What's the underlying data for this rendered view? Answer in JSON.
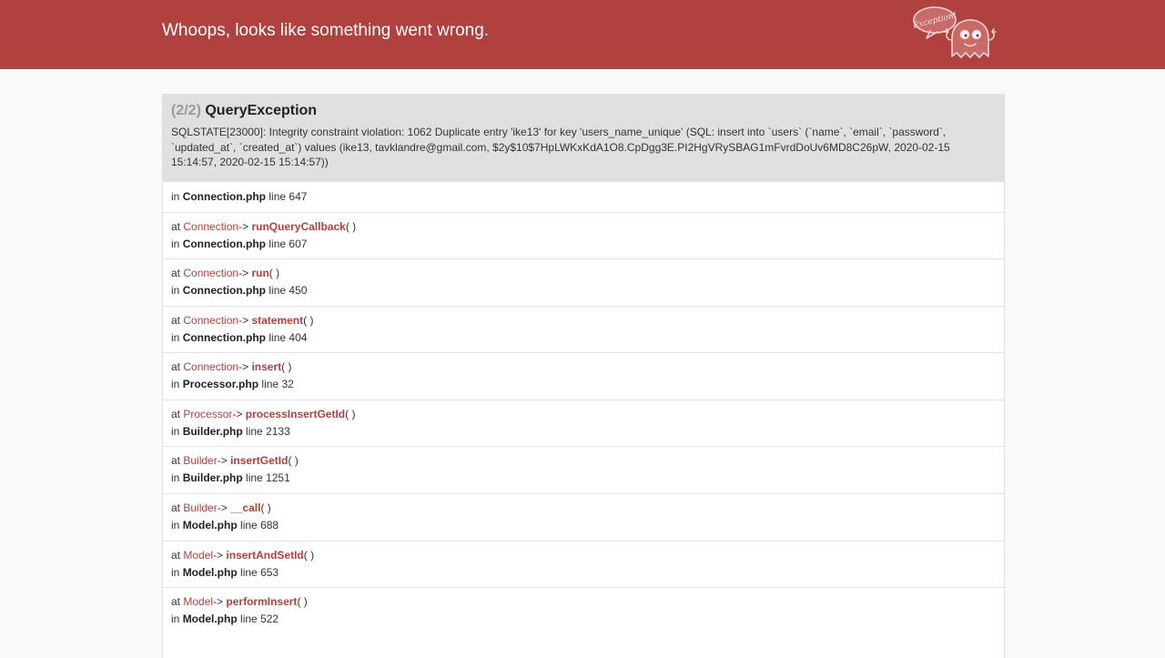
{
  "header": {
    "title": "Whoops, looks like something went wrong.",
    "mascot_bubble_text": "Exception!",
    "brand_color": "#b0413e",
    "mascot_icon": "ghost-icon"
  },
  "exception": {
    "count": "(2/2)",
    "name": "QueryException",
    "message": "SQLSTATE[23000]: Integrity constraint violation: 1062 Duplicate entry 'ike13' for key 'users_name_unique' (SQL: insert into `users` (`name`, `email`, `password`, `updated_at`, `created_at`) values (ike13, tavklandre@gmail.com, $2y$10$7HpLWKxKdA1O8.CpDgg3E.PI2HgVRySBAG1mFvrdDoUv6MD8C26pW, 2020-02-15 15:14:57, 2020-02-15 15:14:57))"
  },
  "labels": {
    "in": "in",
    "at": "at",
    "line": "line",
    "arrow": "->",
    "paren": "( )"
  },
  "origin": {
    "file": "Connection.php",
    "line": "647"
  },
  "frames": [
    {
      "class": "Connection",
      "method": "runQueryCallback",
      "file": "Connection.php",
      "line": "607"
    },
    {
      "class": "Connection",
      "method": "run",
      "file": "Connection.php",
      "line": "450"
    },
    {
      "class": "Connection",
      "method": "statement",
      "file": "Connection.php",
      "line": "404"
    },
    {
      "class": "Connection",
      "method": "insert",
      "file": "Processor.php",
      "line": "32"
    },
    {
      "class": "Processor",
      "method": "processInsertGetId",
      "file": "Builder.php",
      "line": "2133"
    },
    {
      "class": "Builder",
      "method": "insertGetId",
      "file": "Builder.php",
      "line": "1251"
    },
    {
      "class": "Builder",
      "method": "__call",
      "file": "Model.php",
      "line": "688"
    },
    {
      "class": "Model",
      "method": "insertAndSetId",
      "file": "Model.php",
      "line": "653"
    },
    {
      "class": "Model",
      "method": "performInsert",
      "file": "Model.php",
      "line": "522"
    }
  ]
}
